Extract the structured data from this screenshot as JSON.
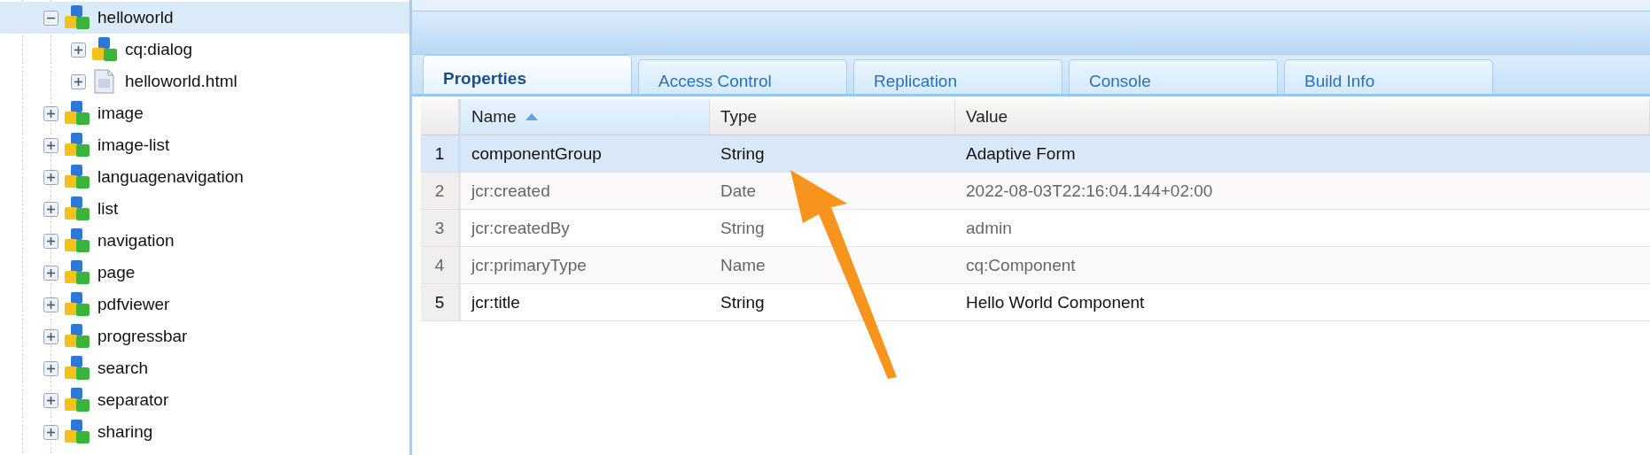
{
  "tree": {
    "items": [
      {
        "label": "helloworld",
        "kind": "component",
        "expanded": true,
        "selected": true,
        "children": [
          {
            "label": "cq:dialog",
            "kind": "component",
            "expanded": false,
            "selected": false
          },
          {
            "label": "helloworld.html",
            "kind": "file",
            "expanded": false,
            "selected": false
          }
        ]
      },
      {
        "label": "image",
        "kind": "component",
        "expanded": false,
        "selected": false
      },
      {
        "label": "image-list",
        "kind": "component",
        "expanded": false,
        "selected": false
      },
      {
        "label": "languagenavigation",
        "kind": "component",
        "expanded": false,
        "selected": false
      },
      {
        "label": "list",
        "kind": "component",
        "expanded": false,
        "selected": false
      },
      {
        "label": "navigation",
        "kind": "component",
        "expanded": false,
        "selected": false
      },
      {
        "label": "page",
        "kind": "component",
        "expanded": false,
        "selected": false
      },
      {
        "label": "pdfviewer",
        "kind": "component",
        "expanded": false,
        "selected": false
      },
      {
        "label": "progressbar",
        "kind": "component",
        "expanded": false,
        "selected": false
      },
      {
        "label": "search",
        "kind": "component",
        "expanded": false,
        "selected": false
      },
      {
        "label": "separator",
        "kind": "component",
        "expanded": false,
        "selected": false
      },
      {
        "label": "sharing",
        "kind": "component",
        "expanded": false,
        "selected": false
      }
    ]
  },
  "tabs": [
    {
      "label": "Properties",
      "selected": true
    },
    {
      "label": "Access Control",
      "selected": false
    },
    {
      "label": "Replication",
      "selected": false
    },
    {
      "label": "Console",
      "selected": false
    },
    {
      "label": "Build Info",
      "selected": false
    }
  ],
  "table": {
    "columns": [
      {
        "label": "Name",
        "sorted": true
      },
      {
        "label": "Type",
        "sorted": false
      },
      {
        "label": "Value",
        "sorted": false
      }
    ],
    "rows": [
      {
        "index": "1",
        "name": "componentGroup",
        "type": "String",
        "value": "Adaptive Form",
        "selected": true,
        "protected": false
      },
      {
        "index": "2",
        "name": "jcr:created",
        "type": "Date",
        "value": "2022-08-03T22:16:04.144+02:00",
        "selected": false,
        "protected": true
      },
      {
        "index": "3",
        "name": "jcr:createdBy",
        "type": "String",
        "value": "admin",
        "selected": false,
        "protected": true
      },
      {
        "index": "4",
        "name": "jcr:primaryType",
        "type": "Name",
        "value": "cq:Component",
        "selected": false,
        "protected": true
      },
      {
        "index": "5",
        "name": "jcr:title",
        "type": "String",
        "value": "Hello World Component",
        "selected": false,
        "protected": false
      }
    ]
  }
}
